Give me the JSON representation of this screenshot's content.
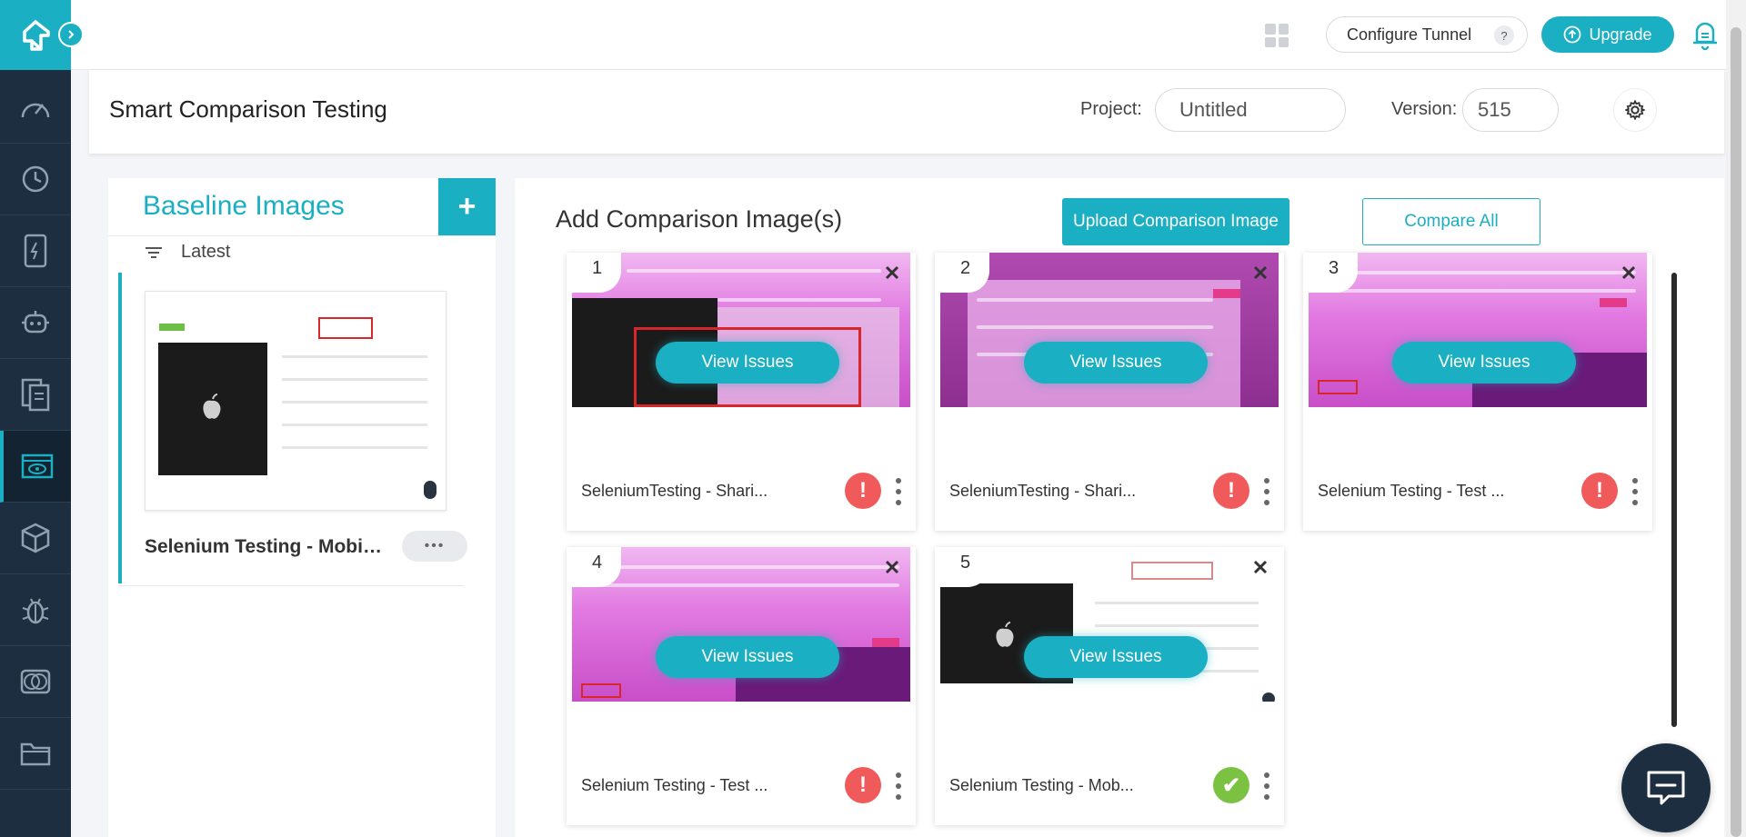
{
  "app": {
    "title": "Smart Comparison Testing",
    "accent": "#1aafc2",
    "sidebar_bg": "#1c2e3f"
  },
  "sidebar": {
    "items": [
      {
        "icon": "speedometer-icon"
      },
      {
        "icon": "clock-icon"
      },
      {
        "icon": "mobile-bolt-icon"
      },
      {
        "icon": "robot-icon"
      },
      {
        "icon": "documents-icon"
      },
      {
        "icon": "eye-screen-icon",
        "active": true
      },
      {
        "icon": "box-icon"
      },
      {
        "icon": "bug-icon"
      },
      {
        "icon": "compare-circles-icon"
      },
      {
        "icon": "folder-icon"
      }
    ]
  },
  "topbar": {
    "configure_tunnel": "Configure Tunnel",
    "help": "?",
    "upgrade": "Upgrade"
  },
  "header": {
    "project_label": "Project:",
    "project_value": "Untitled",
    "version_label": "Version:",
    "version_value": "515"
  },
  "baseline": {
    "title": "Baseline Images",
    "add": "+",
    "sort_label": "Latest",
    "item_name": "Selenium Testing - Mobile ...",
    "more": "•••"
  },
  "comparison": {
    "title": "Add Comparison Image(s)",
    "upload_label": "Upload Comparison Image",
    "compare_all_label": "Compare All",
    "view_label": "View Issues",
    "cards": [
      {
        "num": "1",
        "name": "SeleniumTesting - Shari...",
        "status": "issue",
        "status_glyph": "!"
      },
      {
        "num": "2",
        "name": "SeleniumTesting - Shari...",
        "status": "issue",
        "status_glyph": "!"
      },
      {
        "num": "3",
        "name": "Selenium Testing - Test ...",
        "status": "issue",
        "status_glyph": "!"
      },
      {
        "num": "4",
        "name": "Selenium Testing - Test ...",
        "status": "issue",
        "status_glyph": "!"
      },
      {
        "num": "5",
        "name": "Selenium Testing - Mob...",
        "status": "ok",
        "status_glyph": "✔"
      }
    ]
  }
}
